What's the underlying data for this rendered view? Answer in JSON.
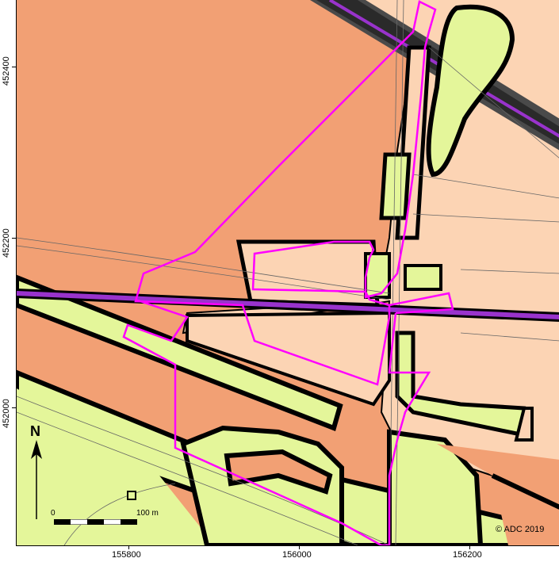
{
  "map": {
    "axes": {
      "y_ticks": [
        "452400",
        "452200",
        "452000"
      ],
      "x_ticks": [
        "155800",
        "156000",
        "156200"
      ]
    },
    "north_arrow": {
      "label": "N",
      "icon": "north-arrow-icon"
    },
    "scale_bar": {
      "start_label": "0",
      "end_label": "100 m"
    },
    "copyright": "© ADC 2019",
    "colors": {
      "salmon": "#f2a074",
      "peach": "#fcd4b4",
      "lime": "#e4f69a",
      "boundary": "#ff00ff",
      "rail": "#9933cc",
      "outline": "#000000"
    }
  }
}
